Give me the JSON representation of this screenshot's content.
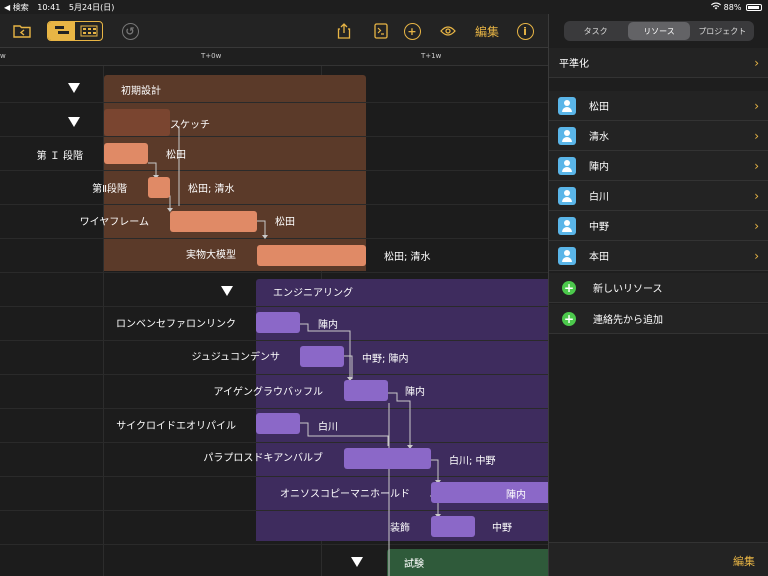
{
  "status": {
    "back": "◀ 検索",
    "time": "10:41",
    "date": "5月24日(日)",
    "battery": "88%"
  },
  "toolbar": {
    "edit_label": "編集",
    "info_label": "i",
    "add_label": "+"
  },
  "timeline": {
    "ticks": [
      "w",
      "T+0w",
      "T+1w"
    ]
  },
  "tasks": [
    {
      "name": "初期設計",
      "resource": ""
    },
    {
      "name": "スケッチ",
      "resource": ""
    },
    {
      "name": "第 Ｉ 段階",
      "resource": "松田"
    },
    {
      "name": "第Ⅱ段階",
      "resource": "松田; 清水"
    },
    {
      "name": "ワイヤフレーム",
      "resource": "松田"
    },
    {
      "name": "実物大模型",
      "resource": "松田; 清水"
    },
    {
      "name": "エンジニアリング",
      "resource": ""
    },
    {
      "name": "ロンベンセファロンリンク",
      "resource": "陣内"
    },
    {
      "name": "ジュジュコンデンサ",
      "resource": "中野; 陣内"
    },
    {
      "name": "アイゲングラウバッフル",
      "resource": "陣内"
    },
    {
      "name": "サイクロイドエオリパイル",
      "resource": "白川"
    },
    {
      "name": "パラプロスドキアンバルブ",
      "resource": "白川; 中野"
    },
    {
      "name": "オニソスコピーマニホールド",
      "resource": "陣内"
    },
    {
      "name": "装飾",
      "resource": "中野"
    },
    {
      "name": "試験",
      "resource": ""
    }
  ],
  "panel": {
    "tabs": [
      "タスク",
      "リソース",
      "プロジェクト"
    ],
    "active_tab": "リソース",
    "leveling": "平準化",
    "resources": [
      "松田",
      "清水",
      "陣内",
      "白川",
      "中野",
      "本田"
    ],
    "new_resource": "新しいリソース",
    "add_from_contacts": "連絡先から追加",
    "edit_label": "編集"
  },
  "colors": {
    "accent": "#e8b545",
    "design_group": "#5b3a29",
    "design_task": "#e08a66",
    "eng_group": "#3e2c5e",
    "eng_task": "#8b68c8",
    "test_group": "#2f5a3a",
    "avatar": "#5ab5e8",
    "add": "#4cc94c"
  }
}
